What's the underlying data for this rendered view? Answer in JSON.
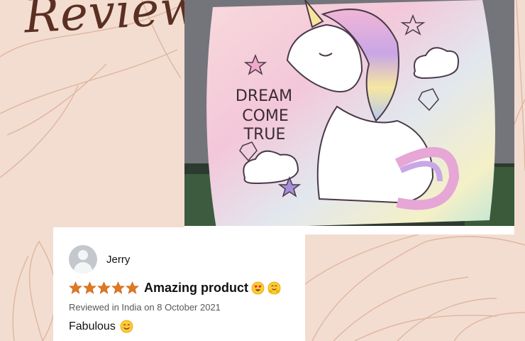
{
  "page": {
    "title": "Review"
  },
  "photo": {
    "pillow_text": [
      "DREAM",
      "COME",
      "TRUE"
    ]
  },
  "review": {
    "reviewer_name": "Jerry",
    "rating": 5,
    "rating_max": 5,
    "headline": "Amazing product",
    "headline_emojis": [
      "heart-eyes-emoji",
      "hugging-face-emoji"
    ],
    "date_text": "Reviewed in India on 8 October 2021",
    "body": "Fabulous",
    "body_emoji": "smiling-face-emoji"
  },
  "colors": {
    "background": "#f3ddd1",
    "title": "#5b2f22",
    "star": "#de7921"
  }
}
